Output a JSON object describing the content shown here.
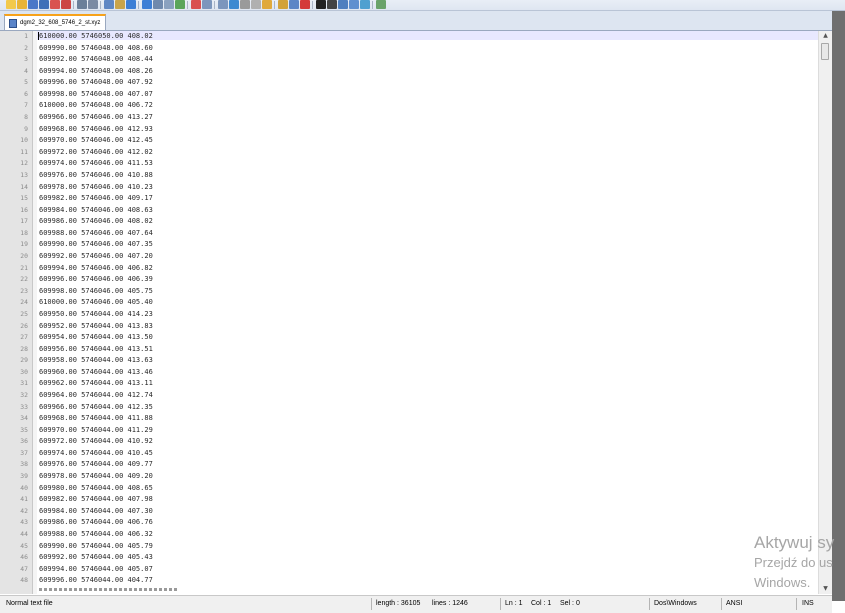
{
  "tab": {
    "label": "dgm2_32_608_5746_2_st.xyz"
  },
  "lines": [
    {
      "n": "1",
      "text": "610000.00 5746050.00 408.02"
    },
    {
      "n": "2",
      "text": "609990.00 5746048.00 408.60"
    },
    {
      "n": "3",
      "text": "609992.00 5746048.00 408.44"
    },
    {
      "n": "4",
      "text": "609994.00 5746048.00 408.26"
    },
    {
      "n": "5",
      "text": "609996.00 5746048.00 407.92"
    },
    {
      "n": "6",
      "text": "609998.00 5746048.00 407.07"
    },
    {
      "n": "7",
      "text": "610000.00 5746048.00 406.72"
    },
    {
      "n": "8",
      "text": "609966.00 5746046.00 413.27"
    },
    {
      "n": "9",
      "text": "609968.00 5746046.00 412.93"
    },
    {
      "n": "10",
      "text": "609970.00 5746046.00 412.45"
    },
    {
      "n": "11",
      "text": "609972.00 5746046.00 412.02"
    },
    {
      "n": "12",
      "text": "609974.00 5746046.00 411.53"
    },
    {
      "n": "13",
      "text": "609976.00 5746046.00 410.88"
    },
    {
      "n": "14",
      "text": "609978.00 5746046.00 410.23"
    },
    {
      "n": "15",
      "text": "609982.00 5746046.00 409.17"
    },
    {
      "n": "16",
      "text": "609984.00 5746046.00 408.63"
    },
    {
      "n": "17",
      "text": "609986.00 5746046.00 408.02"
    },
    {
      "n": "18",
      "text": "609988.00 5746046.00 407.64"
    },
    {
      "n": "19",
      "text": "609990.00 5746046.00 407.35"
    },
    {
      "n": "20",
      "text": "609992.00 5746046.00 407.20"
    },
    {
      "n": "21",
      "text": "609994.00 5746046.00 406.82"
    },
    {
      "n": "22",
      "text": "609996.00 5746046.00 406.39"
    },
    {
      "n": "23",
      "text": "609998.00 5746046.00 405.75"
    },
    {
      "n": "24",
      "text": "610000.00 5746046.00 405.40"
    },
    {
      "n": "25",
      "text": "609950.00 5746044.00 414.23"
    },
    {
      "n": "26",
      "text": "609952.00 5746044.00 413.83"
    },
    {
      "n": "27",
      "text": "609954.00 5746044.00 413.50"
    },
    {
      "n": "28",
      "text": "609956.00 5746044.00 413.51"
    },
    {
      "n": "29",
      "text": "609958.00 5746044.00 413.63"
    },
    {
      "n": "30",
      "text": "609960.00 5746044.00 413.46"
    },
    {
      "n": "31",
      "text": "609962.00 5746044.00 413.11"
    },
    {
      "n": "32",
      "text": "609964.00 5746044.00 412.74"
    },
    {
      "n": "33",
      "text": "609966.00 5746044.00 412.35"
    },
    {
      "n": "34",
      "text": "609968.00 5746044.00 411.88"
    },
    {
      "n": "35",
      "text": "609970.00 5746044.00 411.29"
    },
    {
      "n": "36",
      "text": "609972.00 5746044.00 410.92"
    },
    {
      "n": "37",
      "text": "609974.00 5746044.00 410.45"
    },
    {
      "n": "38",
      "text": "609976.00 5746044.00 409.77"
    },
    {
      "n": "39",
      "text": "609978.00 5746044.00 409.20"
    },
    {
      "n": "40",
      "text": "609980.00 5746044.00 408.65"
    },
    {
      "n": "41",
      "text": "609982.00 5746044.00 407.98"
    },
    {
      "n": "42",
      "text": "609984.00 5746044.00 407.30"
    },
    {
      "n": "43",
      "text": "609986.00 5746044.00 406.76"
    },
    {
      "n": "44",
      "text": "609988.00 5746044.00 406.32"
    },
    {
      "n": "45",
      "text": "609990.00 5746044.00 405.79"
    },
    {
      "n": "46",
      "text": "609992.00 5746044.00 405.43"
    },
    {
      "n": "47",
      "text": "609994.00 5746044.00 405.07"
    },
    {
      "n": "48",
      "text": "609996.00 5746044.00 404.77"
    }
  ],
  "status": {
    "file_type": "Normal text file",
    "length": "length : 36105",
    "lines": "lines : 1246",
    "ln": "Ln : 1",
    "col": "Col : 1",
    "sel": "Sel : 0",
    "eol": "Dos\\Windows",
    "encoding": "ANSI",
    "mode": "INS"
  },
  "watermark": {
    "line1": "Aktywuj sy",
    "line2": "Przejdź do us",
    "line3": "Windows."
  },
  "toolbar_icons": [
    "new-file-icon",
    "open-file-icon",
    "save-icon",
    "save-all-icon",
    "close-icon",
    "close-all-icon",
    "print-icon",
    "cut-icon",
    "copy-icon",
    "paste-icon",
    "undo-icon",
    "redo-icon",
    "find-icon",
    "replace-icon",
    "zoom-in-icon",
    "zoom-out-icon",
    "sync-v-icon",
    "sync-h-icon",
    "word-wrap-icon",
    "show-all-chars-icon",
    "indent-guide-icon",
    "user-lang-icon",
    "doc-map-icon",
    "function-list-icon",
    "record-macro-icon",
    "stop-macro-icon",
    "play-macro-icon",
    "run-macro-icon",
    "save-macro-icon",
    "spell-check-icon",
    "monitor-icon"
  ],
  "colors": {
    "current_line": "#e8e8ff",
    "gutter": "#e4e4e4",
    "tab_accent": "#f7a21a"
  }
}
